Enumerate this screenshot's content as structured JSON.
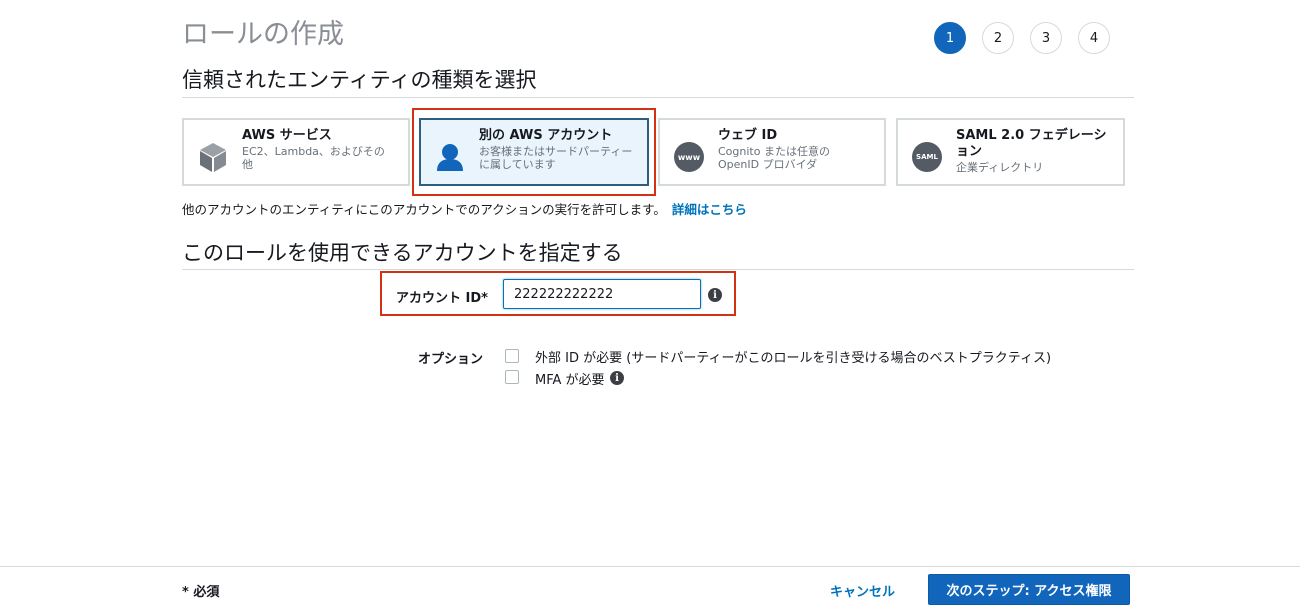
{
  "page": {
    "title": "ロールの作成"
  },
  "steps": [
    "1",
    "2",
    "3",
    "4"
  ],
  "trusted_entity": {
    "heading": "信頼されたエンティティの種類を選択",
    "cards": [
      {
        "title": "AWS サービス",
        "desc": "EC2、Lambda、およびその他",
        "icon": "cube-icon",
        "selected": false
      },
      {
        "title": "別の AWS アカウント",
        "desc": "お客様またはサードパーティーに属しています",
        "icon": "user-icon",
        "selected": true
      },
      {
        "title": "ウェブ ID",
        "desc": "Cognito または任意の OpenID プロバイダ",
        "icon": "www-icon",
        "icon_text": "www",
        "selected": false
      },
      {
        "title": "SAML 2.0 フェデレーション",
        "desc": "企業ディレクトリ",
        "icon": "saml-icon",
        "icon_text": "SAML",
        "selected": false
      }
    ],
    "help_text": "他のアカウントのエンティティにこのアカウントでのアクションの実行を許可します。",
    "help_link": "詳細はこちら"
  },
  "account_section": {
    "heading": "このロールを使用できるアカウントを指定する",
    "account_id_label": "アカウント ID*",
    "account_id_value": "222222222222",
    "options_label": "オプション",
    "options": [
      {
        "label": "外部 ID が必要 (サードパーティーがこのロールを引き受ける場合のベストプラクティス)",
        "checked": false
      },
      {
        "label": "MFA が必要",
        "checked": false
      }
    ]
  },
  "footer": {
    "required_note": "* 必須",
    "cancel_label": "キャンセル",
    "next_label": "次のステップ: アクセス権限"
  },
  "colors": {
    "accent": "#1166bb",
    "highlight": "#d13212",
    "link": "#0073bb"
  }
}
